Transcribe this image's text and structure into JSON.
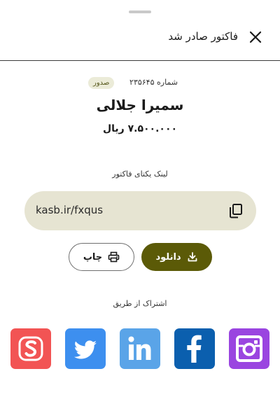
{
  "header": {
    "title": "فاکتور صادر شد"
  },
  "invoice": {
    "number_text": "شماره ۲۳۵۶۴۵",
    "status": "صدور",
    "customer": "سمیرا جلالی",
    "amount": "۷.۵۰۰.۰۰۰ ریال"
  },
  "link": {
    "caption": "لینک یکتای فاکتور",
    "url": "kasb.ir/fxqus"
  },
  "actions": {
    "download_label": "دانلود",
    "print_label": "چاپ"
  },
  "share": {
    "caption": "اشتراک از طریق",
    "channels": [
      "sms-icon",
      "twitter-icon",
      "linkedin-icon",
      "facebook-icon",
      "instagram-icon"
    ]
  },
  "colors": {
    "accent": "#5b5a07",
    "link_box_bg": "#e6e4d2",
    "badge_bg": "#ebebd8",
    "sms": "#f25454",
    "twitter": "#3d8fef",
    "linkedin": "#5aa4e8",
    "facebook": "#0b5fae",
    "instagram": "#9a45e0"
  }
}
